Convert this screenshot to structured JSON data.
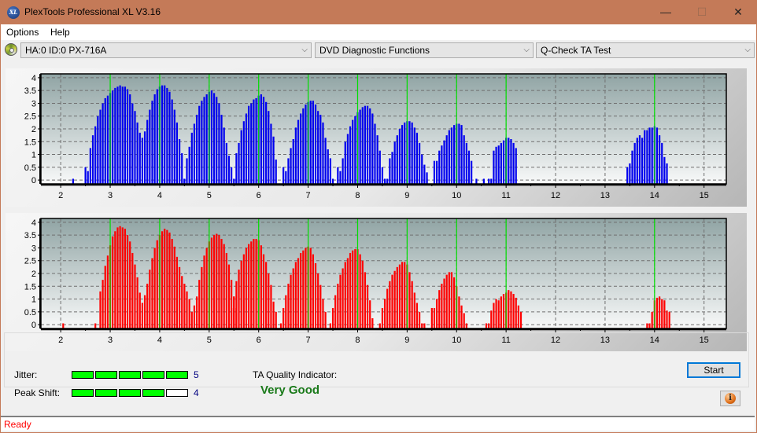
{
  "window": {
    "title": "PlexTools Professional XL V3.16",
    "app_icon_text": "XL",
    "minimize_glyph": "—",
    "maximize_glyph": "☐",
    "close_glyph": "✕"
  },
  "menu": [
    "Options",
    "Help"
  ],
  "toolbar": {
    "drive_select": "HA:0 ID:0  PX-716A",
    "function_select": "DVD Diagnostic Functions",
    "test_select": "Q-Check TA Test",
    "dropdown_glyph": "⌵"
  },
  "colors": {
    "title_bar": "#c47a58",
    "bars_top": "#0000ee",
    "bars_bottom": "#ff0000",
    "marker_lines": "#00e000",
    "meter_on": "#00ff00",
    "quality_text": "#1a7a1a",
    "status_text": "#ff0000"
  },
  "chart_data": [
    {
      "type": "bar",
      "name": "ta-land-distribution",
      "title": "",
      "xlabel": "",
      "ylabel": "",
      "xlim": [
        1.6,
        15.45
      ],
      "ylim": [
        -0.15,
        4.15
      ],
      "x_ticks": [
        2,
        3,
        4,
        5,
        6,
        7,
        8,
        9,
        10,
        11,
        12,
        13,
        14,
        15
      ],
      "y_ticks": [
        "0",
        "0.5",
        "1",
        "1.5",
        "2",
        "2.5",
        "3",
        "3.5",
        "4"
      ],
      "y_tick_values": [
        0,
        0.5,
        1,
        1.5,
        2,
        2.5,
        3,
        3.5,
        4
      ],
      "marker_x": [
        3,
        4,
        5,
        6,
        7,
        8,
        9,
        10,
        11,
        14
      ],
      "bin_width": 0.05,
      "color": "#0000ee",
      "groups": [
        {
          "start": 2.25,
          "values": [
            0.05
          ]
        },
        {
          "start": 2.5,
          "values": [
            0.5,
            0.35,
            1.25,
            1.75,
            2.1,
            2.5,
            2.75,
            3.0,
            3.2,
            3.3,
            3.4,
            3.5,
            3.6,
            3.65,
            3.7,
            3.65,
            3.65,
            3.55,
            3.35,
            3.0,
            2.7,
            2.25,
            1.85,
            1.65,
            1.9,
            2.35,
            2.75,
            3.1,
            3.35,
            3.55,
            3.65,
            3.7,
            3.7,
            3.6,
            3.45,
            3.15,
            2.75,
            2.25,
            1.6,
            1.05,
            0.05
          ]
        },
        {
          "start": 4.5,
          "values": [
            0.05,
            0.85,
            1.3,
            1.85,
            2.2,
            2.55,
            2.9,
            3.1,
            3.25,
            3.35,
            3.45,
            3.5,
            3.4,
            3.25,
            3.0,
            2.55,
            2.05,
            1.45,
            0.95,
            0.5,
            0.05,
            0.05
          ]
        },
        {
          "start": 5.55,
          "values": [
            1.05,
            1.45,
            1.95,
            2.3,
            2.6,
            2.9,
            3.0,
            3.15,
            3.2,
            3.3,
            3.35,
            3.25,
            3.05,
            2.7,
            2.2,
            1.7,
            0.8
          ]
        },
        {
          "start": 6.5,
          "values": [
            0.5,
            0.35,
            0.85,
            1.25,
            1.6,
            2.05,
            2.35,
            2.6,
            2.8,
            2.95,
            3.05,
            3.1,
            3.1,
            2.95,
            2.7,
            2.55,
            2.25,
            1.65,
            1.2,
            0.85,
            0.05
          ]
        },
        {
          "start": 7.6,
          "values": [
            0.5,
            0.35,
            0.85,
            1.5,
            1.8,
            2.1,
            2.35,
            2.5,
            2.65,
            2.75,
            2.85,
            2.9,
            2.9,
            2.8,
            2.6,
            2.2,
            1.75,
            1.15,
            0.5,
            0.05
          ]
        },
        {
          "start": 8.55,
          "values": [
            0.05,
            0.05,
            0.85,
            1.1,
            1.5,
            1.75,
            2.0,
            2.15,
            2.25,
            2.3,
            2.3,
            2.25,
            2.05,
            1.85,
            1.45,
            1.0,
            0.6,
            0.3
          ]
        },
        {
          "start": 9.4,
          "values": [
            0.05
          ]
        },
        {
          "start": 9.55,
          "values": [
            0.75,
            0.75,
            1.15,
            1.35,
            1.55,
            1.75,
            1.95,
            2.05,
            2.15,
            2.2,
            2.2,
            2.15,
            1.75,
            1.45,
            1.15,
            0.75
          ]
        },
        {
          "start": 10.4,
          "values": [
            0.05
          ]
        },
        {
          "start": 10.55,
          "values": [
            0.05
          ]
        },
        {
          "start": 10.65,
          "values": [
            0.05,
            0.05,
            1.15,
            1.3,
            1.35,
            1.45,
            1.55,
            1.65,
            1.65,
            1.6,
            1.45,
            1.25
          ]
        },
        {
          "start": 13.45,
          "values": [
            0.5,
            0.65,
            1.15,
            1.45,
            1.65,
            1.75,
            1.65,
            1.95,
            1.95,
            2.05,
            2.05,
            2.1,
            2.05,
            1.75,
            1.45,
            0.9,
            0.65
          ]
        },
        {
          "start": 14.2,
          "values": [
            0.05,
            0.05
          ]
        }
      ]
    },
    {
      "type": "bar",
      "name": "ta-pit-distribution",
      "title": "",
      "xlabel": "",
      "ylabel": "",
      "xlim": [
        1.6,
        15.45
      ],
      "ylim": [
        -0.15,
        4.15
      ],
      "x_ticks": [
        2,
        3,
        4,
        5,
        6,
        7,
        8,
        9,
        10,
        11,
        12,
        13,
        14,
        15
      ],
      "y_ticks": [
        "0",
        "0.5",
        "1",
        "1.5",
        "2",
        "2.5",
        "3",
        "3.5",
        "4"
      ],
      "y_tick_values": [
        0,
        0.5,
        1,
        1.5,
        2,
        2.5,
        3,
        3.5,
        4
      ],
      "marker_x": [
        3,
        4,
        5,
        6,
        7,
        8,
        9,
        10,
        11,
        14
      ],
      "bin_width": 0.05,
      "color": "#ff0000",
      "groups": [
        {
          "start": 2.05,
          "values": [
            0.05
          ]
        },
        {
          "start": 2.7,
          "values": [
            0.05,
            0.0,
            1.3,
            1.75,
            2.3,
            2.7,
            3.1,
            3.45,
            3.65,
            3.8,
            3.85,
            3.8,
            3.75,
            3.5,
            3.25,
            2.8,
            2.35,
            1.85,
            1.25,
            0.85,
            1.15,
            1.6,
            2.15,
            2.6,
            3.0,
            3.3,
            3.5,
            3.65,
            3.75,
            3.7,
            3.6,
            3.35,
            3.05,
            2.65,
            2.25,
            1.9,
            1.6,
            1.3,
            1.0,
            0.5,
            0.75,
            1.1,
            1.75,
            2.25,
            2.7,
            3.0,
            3.25,
            3.4,
            3.5,
            3.55,
            3.5,
            3.35,
            3.15,
            2.8,
            2.35,
            1.75,
            1.1,
            0.65
          ]
        },
        {
          "start": 5.45,
          "values": [
            0.65,
            1.1,
            1.7,
            2.15,
            2.5,
            2.75,
            3.0,
            3.15,
            3.25,
            3.35,
            3.35,
            3.3,
            3.1,
            2.75,
            2.45,
            2.0,
            1.55,
            0.9,
            0.5
          ]
        },
        {
          "start": 6.45,
          "values": [
            0.05,
            0.65,
            1.15,
            1.6,
            1.95,
            2.2,
            2.45,
            2.6,
            2.8,
            2.9,
            3.0,
            3.05,
            3.0,
            2.75,
            2.4,
            2.0,
            1.55,
            1.0,
            0.5
          ]
        },
        {
          "start": 7.45,
          "values": [
            0.05,
            0.65,
            1.15,
            1.6,
            1.95,
            2.2,
            2.45,
            2.6,
            2.8,
            2.9,
            2.95,
            2.95,
            2.75,
            2.5,
            2.05,
            1.55,
            0.95,
            0.25
          ]
        },
        {
          "start": 8.45,
          "values": [
            0.05,
            0.65,
            1.0,
            1.4,
            1.7,
            1.95,
            2.1,
            2.25,
            2.35,
            2.45,
            2.45,
            2.35,
            2.05,
            1.7,
            1.25,
            0.85,
            0.5,
            0.05,
            0.05
          ]
        },
        {
          "start": 9.5,
          "values": [
            0.65,
            0.65,
            1.0,
            1.35,
            1.6,
            1.8,
            1.95,
            2.05,
            2.05,
            1.85,
            1.5,
            1.1,
            0.75,
            0.45,
            0.05
          ]
        },
        {
          "start": 10.6,
          "values": [
            0.05,
            0.05,
            0.55,
            0.85,
            1.0,
            0.95,
            1.1,
            1.2,
            1.25,
            1.35,
            1.3,
            1.2,
            1.05,
            0.75,
            0.5
          ]
        },
        {
          "start": 13.85,
          "values": [
            0.05,
            0.05,
            0.5,
            0.95,
            1.05,
            1.1,
            1.0,
            0.95,
            0.55,
            0.5
          ]
        }
      ]
    }
  ],
  "metrics": {
    "jitter": {
      "label": "Jitter:",
      "value": "5",
      "segments_on": 5,
      "segments_total": 5
    },
    "peak_shift": {
      "label": "Peak Shift:",
      "value": "4",
      "segments_on": 4,
      "segments_total": 5
    },
    "quality_label": "TA Quality Indicator:",
    "quality_value": "Very Good"
  },
  "buttons": {
    "start": "Start",
    "info_glyph": "i"
  },
  "status": "Ready"
}
